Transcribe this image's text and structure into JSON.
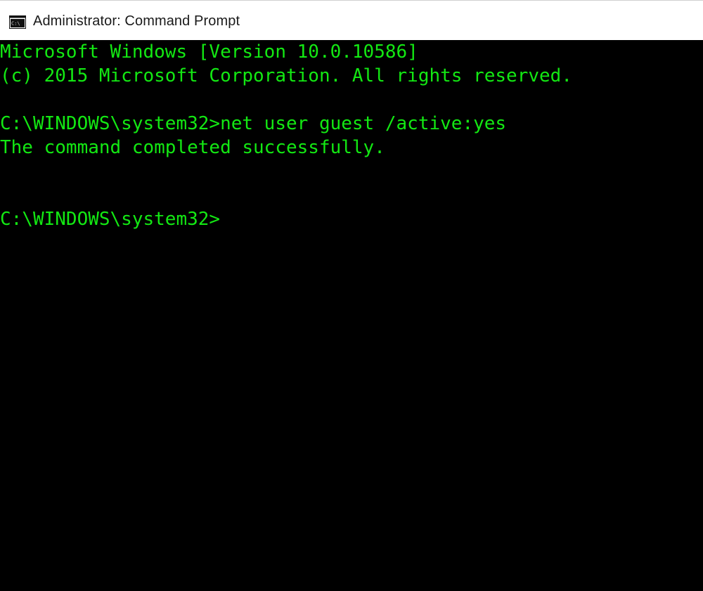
{
  "window": {
    "title": "Administrator: Command Prompt",
    "icon": "cmd-icon",
    "colors": {
      "console_background": "#000000",
      "console_text": "#13e813",
      "titlebar_background": "#ffffff"
    }
  },
  "console": {
    "lines": [
      "Microsoft Windows [Version 10.0.10586]",
      "(c) 2015 Microsoft Corporation. All rights reserved.",
      "",
      "C:\\WINDOWS\\system32>net user guest /active:yes",
      "The command completed successfully.",
      "",
      "",
      "C:\\WINDOWS\\system32>"
    ]
  }
}
